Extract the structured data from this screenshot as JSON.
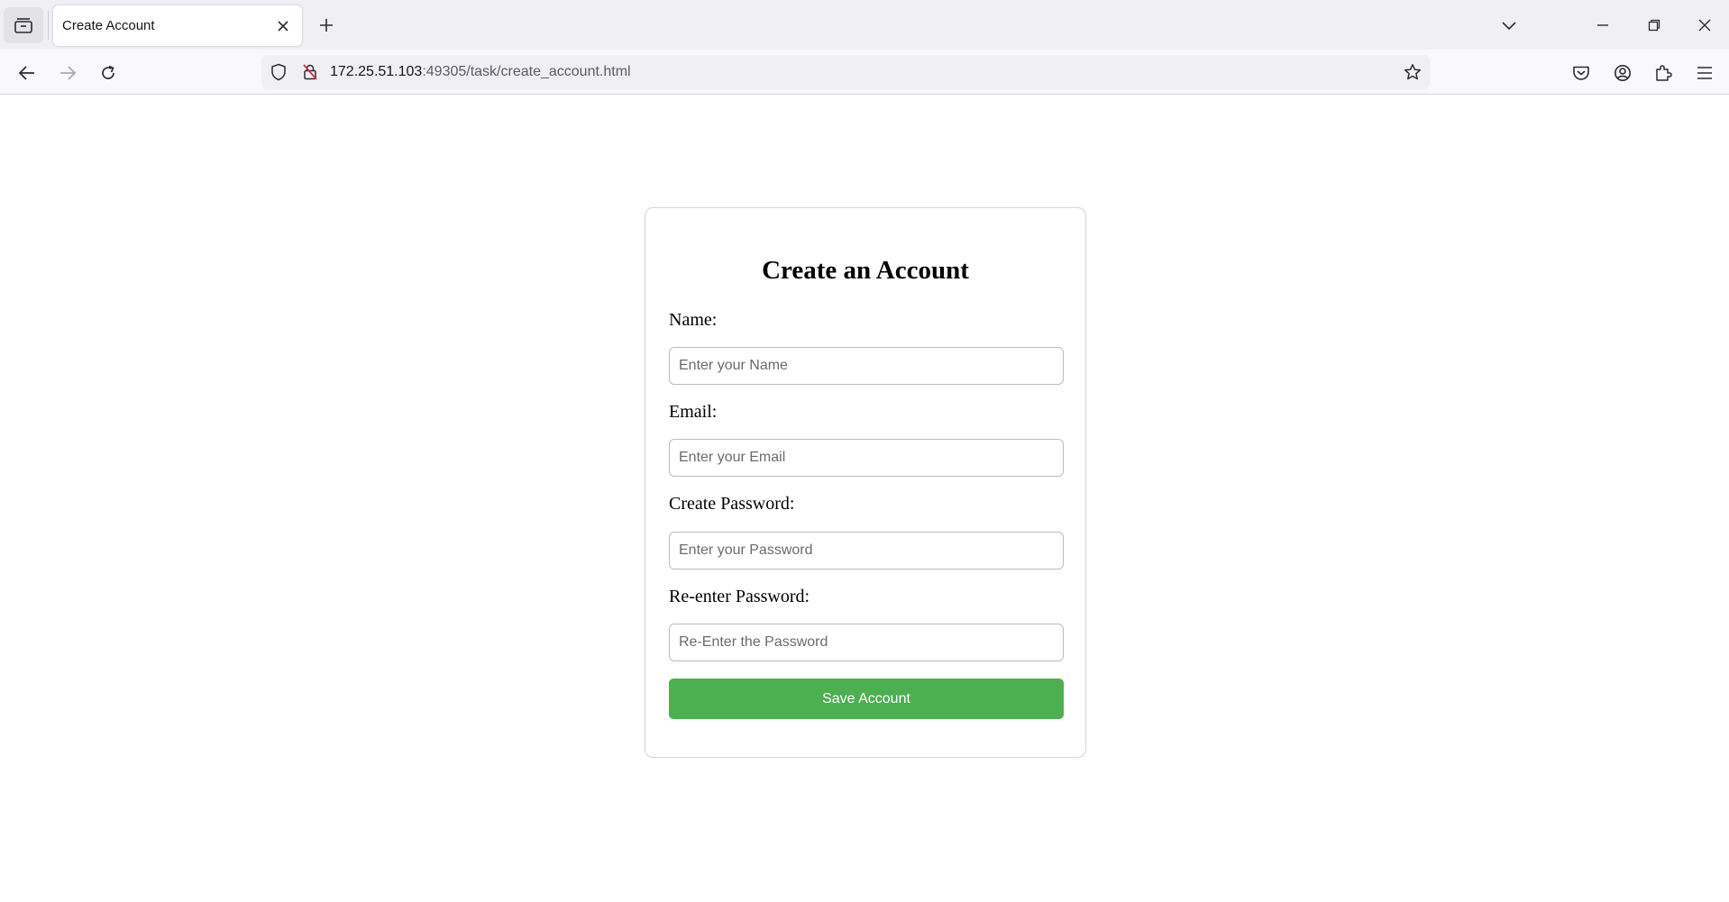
{
  "browser": {
    "tab": {
      "title": "Create Account"
    },
    "url": {
      "host": "172.25.51.103",
      "rest": ":49305/task/create_account.html"
    }
  },
  "form": {
    "title": "Create an Account",
    "fields": [
      {
        "label": "Name:",
        "placeholder": "Enter your Name",
        "value": ""
      },
      {
        "label": "Email:",
        "placeholder": "Enter your Email",
        "value": ""
      },
      {
        "label": "Create Password:",
        "placeholder": "Enter your Password",
        "value": ""
      },
      {
        "label": "Re-enter Password:",
        "placeholder": "Re-Enter the Password",
        "value": ""
      }
    ],
    "submit_label": "Save Account"
  },
  "colors": {
    "accent_button": "#4caf50",
    "card_border": "#d6d6d6"
  },
  "icons": {
    "tab_overview": "tab-overview-icon",
    "tab_close": "close-icon",
    "new_tab": "plus-icon",
    "tab_list": "chevron-down-icon",
    "back": "arrow-left-icon",
    "forward": "arrow-right-icon",
    "reload": "reload-icon",
    "tracking": "shield-icon",
    "insecure": "insecure-lock-icon",
    "bookmark": "star-icon",
    "pocket": "pocket-icon",
    "account": "account-icon",
    "extensions": "puzzle-icon",
    "menu": "hamburger-menu-icon"
  }
}
